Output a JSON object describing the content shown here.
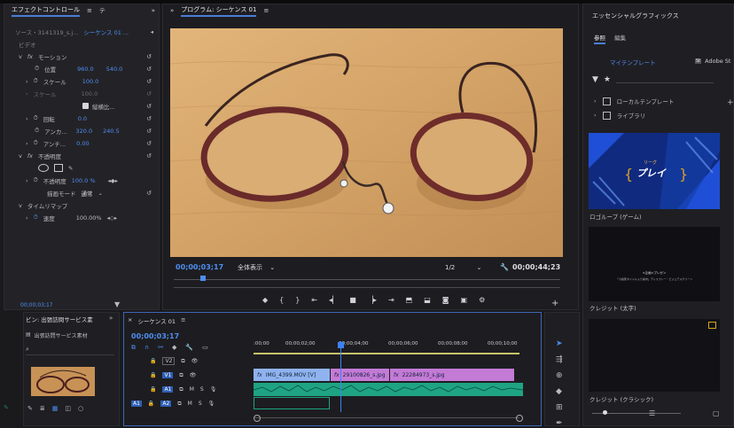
{
  "effect_controls": {
    "tab_label": "エフェクトコントロール",
    "source_label": "ソース・3141319_s.j...",
    "sequence_label": "シーケンス 01 ...",
    "video_heading": "ビデオ",
    "motion": "モーション",
    "position_label": "位置",
    "position_x": "960.0",
    "position_y": "540.0",
    "scale_label": "スケール",
    "scale_value": "100.0",
    "scale_width_label": "スケール",
    "scale_width_value": "100.0",
    "uniform_scale": "縦横比...",
    "rotation_label": "回転",
    "rotation_value": "0.0",
    "anchor_label": "アンカ...",
    "anchor_x": "320.0",
    "anchor_y": "240.5",
    "antiflicker_label": "アンチ...",
    "antiflicker_value": "0.00",
    "opacity_group": "不透明度",
    "opacity_label": "不透明度",
    "opacity_value": "100.0 %",
    "blend_label": "描画モード",
    "blend_value": "通常",
    "time_remap": "タイムリマップ",
    "speed_label": "速度",
    "speed_value": "100.00%",
    "timecode": "00;00;03;17"
  },
  "program": {
    "title": "プログラム: シーケンス 01",
    "timecode": "00;00;03;17",
    "fit": "全体表示",
    "resolution": "1/2",
    "duration": "00;00;44;23"
  },
  "essential_graphics": {
    "title": "エッセンシャルグラフィックス",
    "tab_browse": "参照",
    "tab_edit": "編集",
    "my_templates": "マイテンプレート",
    "adobe_stock": "Adobe St",
    "local_templates": "ローカルテンプレート",
    "libraries": "ライブラリ",
    "card1_caption": "ロゴループ (ゲーム)",
    "card1_art_small": "リーグ",
    "card1_art_big": "プレイ",
    "card2_caption": "クレジット (太字)",
    "card2_line1": "<企画>プレゼン",
    "card2_line2": "「小説家タイトル入り案内」ディスプレー・ビジュアルグリーン",
    "card3_caption": "クレジット (クラシック)"
  },
  "project": {
    "tab_label": "ビン: 出張訪問サービス素",
    "bin_label": "出張訪問サービス素材"
  },
  "timeline": {
    "tab_label": "シーケンス 01",
    "timecode": "00;00;03;17",
    "ruler": [
      ":00;00",
      "00;00;02;00",
      "00;00;04;00",
      "00;00;06;00",
      "00;00;08;00",
      "00;00;10;00"
    ],
    "tracks": [
      {
        "name": "V2",
        "lock": "🔒"
      },
      {
        "name": "V1",
        "lock": "🔒"
      },
      {
        "name": "A1",
        "lock": "🔒"
      },
      {
        "name": "A2",
        "lock": "🔒"
      }
    ],
    "source_v": "V1",
    "source_a": "A1",
    "m": "M",
    "s": "S",
    "clips": [
      "IMG_4399.MOV [V]",
      "29100826_s.jpg",
      "22284973_s.jpg"
    ],
    "fx": "fx"
  },
  "colors": {
    "accent": "#4f8df0",
    "video_clip": "#8fb3ee",
    "image_clip": "#c47bd6",
    "audio_clip": "#1fa483",
    "playhead": "#3b82f6"
  }
}
